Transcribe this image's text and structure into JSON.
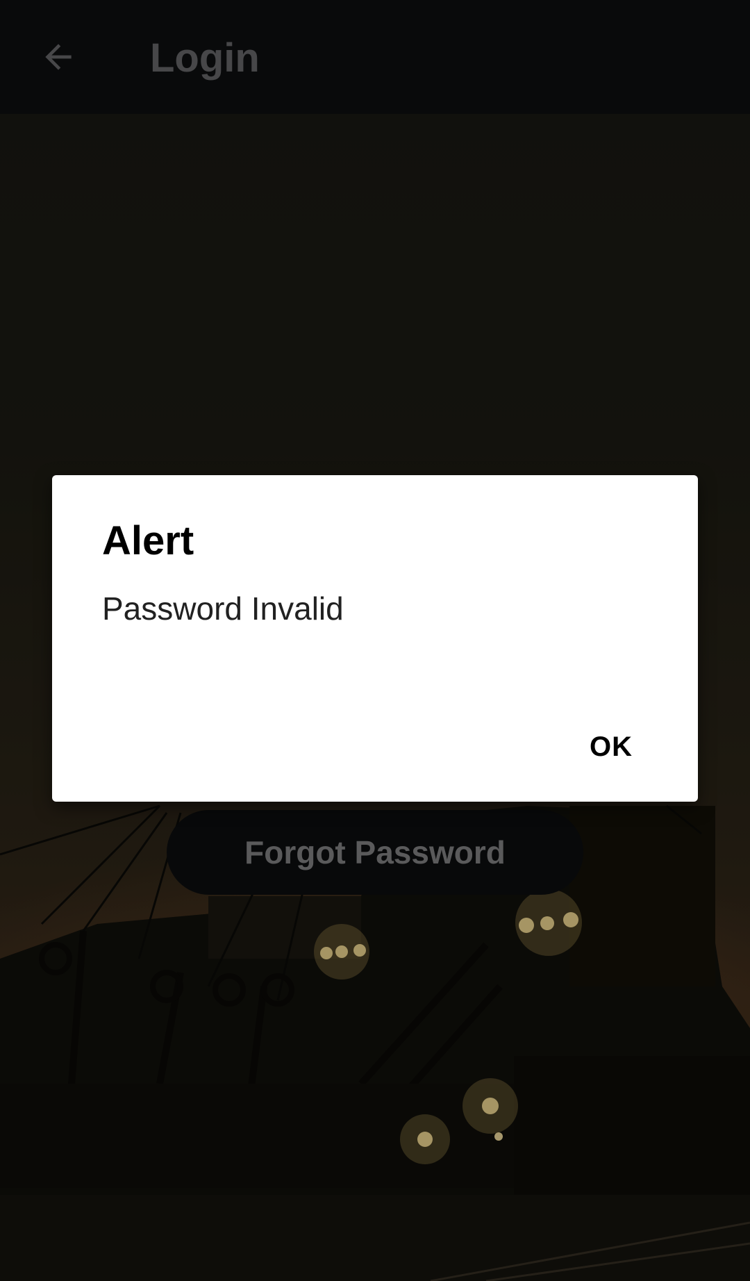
{
  "app_bar": {
    "title": "Login",
    "back_icon": "arrow-left-icon"
  },
  "main": {
    "forgot_password_label": "Forgot Password"
  },
  "dialog": {
    "title": "Alert",
    "message": "Password Invalid",
    "ok_label": "OK"
  },
  "colors": {
    "app_bar_bg": "#0f1012",
    "dialog_bg": "#ffffff",
    "button_bg": "#0d0e10"
  }
}
